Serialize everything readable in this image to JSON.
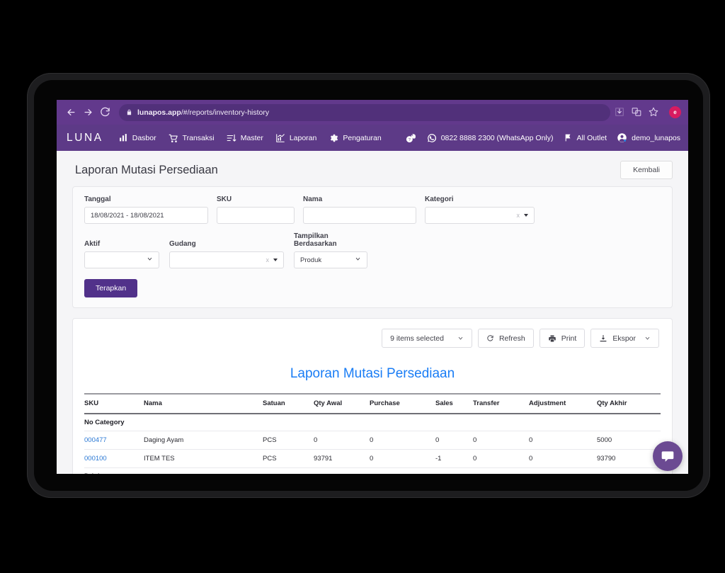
{
  "browser": {
    "back_icon": "arrow-left-icon",
    "forward_icon": "arrow-right-icon",
    "reload_icon": "reload-icon",
    "lock_icon": "lock-icon",
    "url_host": "lunapos.app",
    "url_path": "/#/reports/inventory-history",
    "download_icon": "download-icon",
    "translate_icon": "translate-icon",
    "bookmark_icon": "star-icon",
    "profile_initial": "e"
  },
  "appnav": {
    "logo": "LUNA",
    "items": [
      {
        "label": "Dasbor",
        "icon": "bar-chart-icon"
      },
      {
        "label": "Transaksi",
        "icon": "cart-icon"
      },
      {
        "label": "Master",
        "icon": "sort-list-icon"
      },
      {
        "label": "Laporan",
        "icon": "report-chart-icon"
      },
      {
        "label": "Pengaturan",
        "icon": "gear-icon"
      }
    ],
    "help_icon": "help-icon",
    "whatsapp_icon": "whatsapp-icon",
    "whatsapp_label": "0822 8888 2300 (WhatsApp Only)",
    "outlet_icon": "flag-icon",
    "outlet_label": "All Outlet",
    "user_icon": "user-avatar-icon",
    "user_label": "demo_lunapos"
  },
  "page": {
    "title": "Laporan Mutasi Persediaan",
    "back_button": "Kembali"
  },
  "filters": {
    "tanggal": {
      "label": "Tanggal",
      "value": "18/08/2021 - 18/08/2021"
    },
    "sku": {
      "label": "SKU",
      "value": "",
      "placeholder": ""
    },
    "nama": {
      "label": "Nama",
      "value": "",
      "placeholder": ""
    },
    "kategori": {
      "label": "Kategori",
      "value": "",
      "clear": "x"
    },
    "aktif": {
      "label": "Aktif",
      "value": ""
    },
    "gudang": {
      "label": "Gudang",
      "value": "",
      "clear": "x"
    },
    "tampilkan": {
      "label": "Tampilkan Berdasarkan",
      "value": "Produk"
    },
    "apply_button": "Terapkan"
  },
  "toolbar": {
    "items_selected": "9 items selected",
    "refresh_label": "Refresh",
    "refresh_icon": "refresh-icon",
    "print_label": "Print",
    "print_icon": "printer-icon",
    "export_label": "Ekspor",
    "export_icon": "download-tray-icon"
  },
  "report": {
    "title": "Laporan Mutasi Persediaan",
    "columns": [
      "SKU",
      "Nama",
      "Satuan",
      "Qty Awal",
      "Purchase",
      "Sales",
      "Transfer",
      "Adjustment",
      "Qty Akhir"
    ],
    "groups": [
      {
        "category": "No Category",
        "rows": [
          {
            "sku": "000477",
            "nama": "Daging Ayam",
            "satuan": "PCS",
            "qty_awal": "0",
            "purchase": "0",
            "sales": "0",
            "transfer": "0",
            "adjustment": "0",
            "qty_akhir": "5000"
          },
          {
            "sku": "000100",
            "nama": "ITEM TES",
            "satuan": "PCS",
            "qty_awal": "93791",
            "purchase": "0",
            "sales": "-1",
            "transfer": "0",
            "adjustment": "0",
            "qty_akhir": "93790"
          }
        ]
      },
      {
        "category": "Drink",
        "rows": []
      }
    ]
  },
  "chat": {
    "icon": "chat-bubble-icon"
  },
  "colors": {
    "browser_bar": "#62398c",
    "app_nav": "#5d3a87",
    "primary_button": "#51318a",
    "report_title": "#1a7df5",
    "link": "#2a78d4",
    "page_bg": "#f5f5f7"
  }
}
